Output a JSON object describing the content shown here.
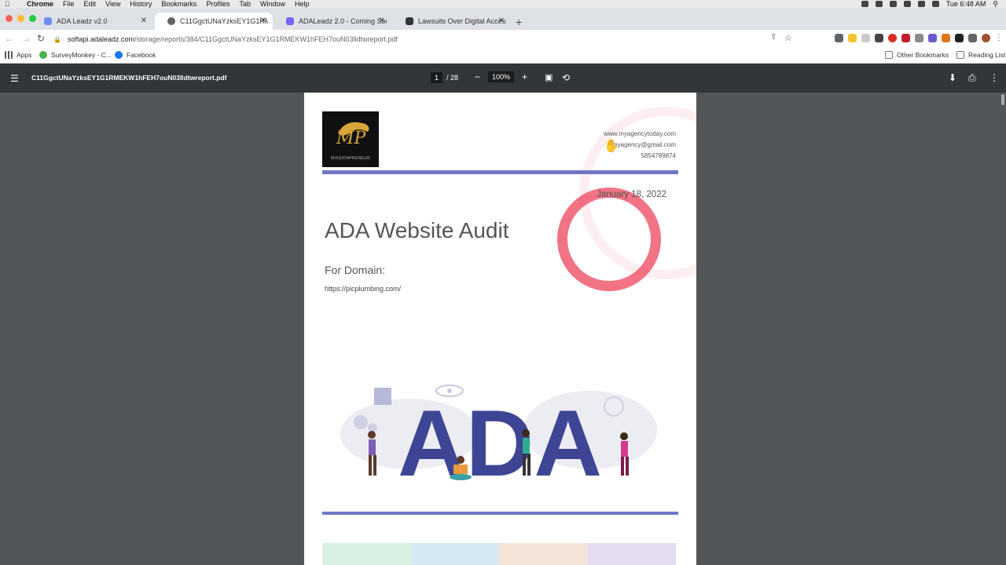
{
  "menubar": {
    "app": "Chrome",
    "items": [
      "File",
      "Edit",
      "View",
      "History",
      "Bookmarks",
      "Profiles",
      "Tab",
      "Window",
      "Help"
    ],
    "clock": "Tue 6:48 AM"
  },
  "tabs": [
    {
      "title": "ADA Leadz v2.0",
      "color": "#6c8ef5"
    },
    {
      "title": "C11GgctUNaYzksEY1G1RMEKW...",
      "color": "#5f6368"
    },
    {
      "title": "ADALeadz 2.0 - Coming Soon!",
      "color": "#7b61ff"
    },
    {
      "title": "Lawsuits Over Digital Accessib...",
      "color": "#333333"
    }
  ],
  "toolbar": {
    "url_host": "softapi.adaleadz.com",
    "url_path": "/storage/reports/384/C11GgctUNaYzksEY1G1RMEKW1hFEH7ouN03lldtwreport.pdf"
  },
  "bookmarks": {
    "apps": "Apps",
    "surveymonkey": "SurveyMonkey - C...",
    "facebook": "Facebook",
    "other": "Other Bookmarks",
    "reading": "Reading List"
  },
  "pdf": {
    "filename": "C11GgctUNaYzksEY1G1RMEKW1hFEH7ouN03lldtwreport.pdf",
    "page": "1",
    "total": "/ 28",
    "zoom": "100%"
  },
  "doc": {
    "logo_text": "MP",
    "logo_name": "MISSIONPRENEUR",
    "website": "www.myagencytoday.com",
    "email": "myagency@gmail.com",
    "phone": "5854789874",
    "date": "January 18, 2022",
    "title": "ADA Website Audit",
    "for_domain": "For Domain:",
    "domain": "https://picplumbing.com/",
    "art_text": "ADA"
  },
  "colors": {
    "accent_rule": "#7077c7",
    "ring": "#ef5b6e",
    "ada_letters": "#3d4594"
  }
}
